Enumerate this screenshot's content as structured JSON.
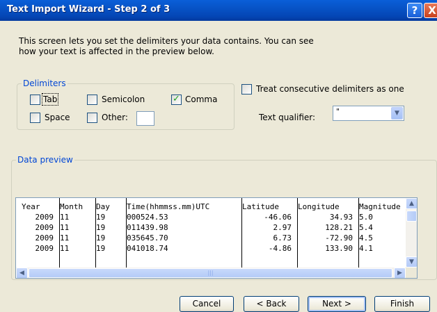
{
  "window": {
    "title": "Text Import Wizard - Step 2 of 3",
    "help_label": "?",
    "close_label": "X"
  },
  "intro": {
    "line1": "This screen lets you set the delimiters your data contains.  You can see",
    "line2": "how your text is affected in the preview below."
  },
  "delimiters": {
    "group_title": "Delimiters",
    "tab": {
      "label": "Tab",
      "checked": false
    },
    "semicolon": {
      "label": "Semicolon",
      "checked": false
    },
    "comma": {
      "label": "Comma",
      "checked": true
    },
    "space": {
      "label": "Space",
      "checked": false
    },
    "other": {
      "label": "Other:",
      "checked": false,
      "value": ""
    }
  },
  "consecutive": {
    "label": "Treat consecutive delimiters as one",
    "checked": false
  },
  "qualifier": {
    "label": "Text qualifier:",
    "value": "\""
  },
  "preview": {
    "group_title": "Data preview",
    "columns": [
      {
        "header": "Year",
        "cells": [
          "2009",
          "2009",
          "2009",
          "2009"
        ],
        "align": "right"
      },
      {
        "header": "Month",
        "cells": [
          "11",
          "11",
          "11",
          "11"
        ],
        "align": "left"
      },
      {
        "header": "Day",
        "cells": [
          "19",
          "19",
          "19",
          "19"
        ],
        "align": "left"
      },
      {
        "header": "Time(hhmmss.mm)UTC",
        "cells": [
          "000524.53",
          "011439.98",
          "035645.70",
          "041018.74"
        ],
        "align": "left"
      },
      {
        "header": "Latitude",
        "cells": [
          "-46.06",
          "2.97",
          "6.73",
          "-4.86"
        ],
        "align": "right"
      },
      {
        "header": "Longitude",
        "cells": [
          "34.93",
          "128.21",
          "-72.90",
          "133.90"
        ],
        "align": "right"
      },
      {
        "header": "Magnitude",
        "cells": [
          "5.0",
          "5.4",
          "4.5",
          "4.1"
        ],
        "align": "left"
      }
    ]
  },
  "buttons": {
    "cancel": "Cancel",
    "back": "< Back",
    "next": "Next >",
    "finish": "Finish"
  },
  "colors": {
    "title_bar": "#0753c6",
    "group_title": "#0046d5",
    "checkmark": "#21a121",
    "dialog_bg": "#ece9d8"
  }
}
